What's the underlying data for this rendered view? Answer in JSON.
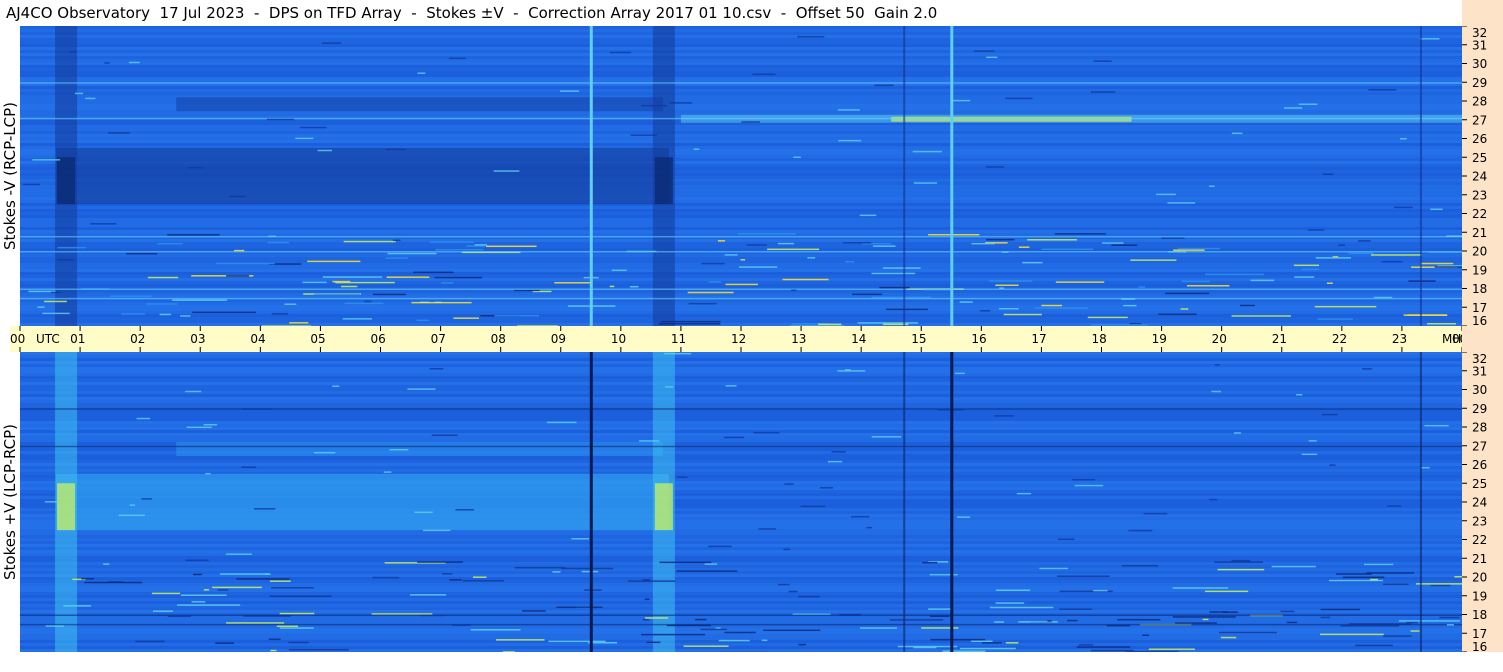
{
  "title": "AJ4CO Observatory  17 Jul 2023  -  DPS on TFD Array  -  Stokes ±V  -  Correction Array 2017 01 10.csv  -  Offset 50  Gain 2.0",
  "chart_data": [
    {
      "type": "heatmap",
      "ylabel": "Stokes -V (RCP-LCP)",
      "y_ticks": [
        "32",
        "31",
        "30",
        "29",
        "28",
        "27",
        "26",
        "25",
        "24",
        "23",
        "22",
        "21",
        "20",
        "19",
        "18",
        "17",
        "16"
      ],
      "ylim": [
        16,
        32
      ],
      "y_unit": "MHz",
      "colormap": [
        "#0a2a80",
        "#1a4fd0",
        "#1f6fe8",
        "#2a90f0",
        "#5fd0f0",
        "#c8f060",
        "#ffe030",
        "#ff5050"
      ],
      "background_color": "#1f66e0",
      "features": {
        "vertical_lines_utc": [
          9.5,
          15.5
        ],
        "dark_columns_utc": [
          0.75,
          10.7
        ],
        "dark_band_mhz": [
          22.5,
          25.5
        ],
        "bright_band_mhz": 27,
        "noise_lines_mhz": [
          17.5,
          18,
          20,
          20.8,
          27.1,
          29
        ]
      }
    },
    {
      "type": "heatmap",
      "ylabel": "Stokes +V (LCP-RCP)",
      "y_ticks": [
        "32",
        "31",
        "30",
        "29",
        "28",
        "27",
        "26",
        "25",
        "24",
        "23",
        "22",
        "21",
        "20",
        "19",
        "18",
        "17",
        "16"
      ],
      "ylim": [
        16,
        32
      ],
      "y_unit": "MHz",
      "colormap": [
        "#0a2a80",
        "#1a4fd0",
        "#1f6fe8",
        "#2a90f0",
        "#5fd0f0",
        "#c8f060",
        "#ffe030",
        "#ff5050"
      ],
      "background_color": "#1f66e0",
      "features": {
        "vertical_lines_utc": [
          9.5,
          15.5
        ],
        "bright_columns_utc": [
          0.75,
          10.7
        ],
        "bright_band_mhz": [
          22.5,
          25.5
        ],
        "dark_lines_mhz": [
          17.5,
          18,
          27,
          29
        ]
      }
    }
  ],
  "time_axis": {
    "label_utc": "UTC",
    "label_mhz": "MHz",
    "ticks": [
      "00",
      "01",
      "02",
      "03",
      "04",
      "05",
      "06",
      "07",
      "08",
      "09",
      "10",
      "11",
      "12",
      "13",
      "14",
      "15",
      "16",
      "17",
      "18",
      "19",
      "20",
      "21",
      "22",
      "23",
      "00"
    ],
    "xlim": [
      0,
      24
    ]
  }
}
